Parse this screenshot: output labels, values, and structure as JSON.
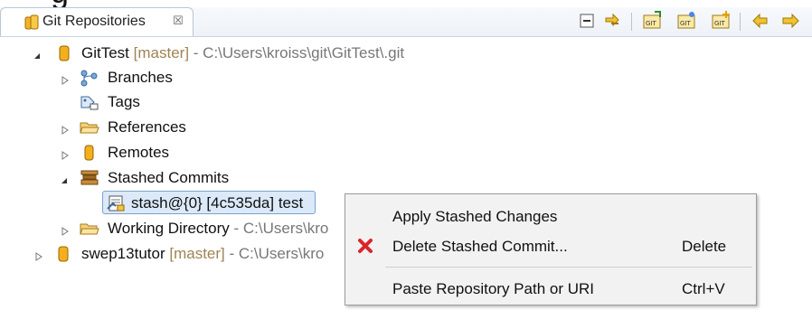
{
  "view": {
    "title": "Git Repositories",
    "close_glyph": "☒"
  },
  "toolbar": [
    {
      "icon": "collapse-all-icon"
    },
    {
      "icon": "link-with-selection-icon"
    },
    {
      "icon": "add-existing-repository-icon"
    },
    {
      "icon": "clone-repository-icon"
    },
    {
      "icon": "create-repository-icon"
    },
    {
      "icon": "refresh-icon"
    },
    {
      "icon": "link-icon"
    }
  ],
  "tree": {
    "repo1": {
      "name": "GitTest",
      "branch": "[master]",
      "path": "- C:\\Users\\kroiss\\git\\GitTest\\.git"
    },
    "branches": "Branches",
    "tags": "Tags",
    "references": "References",
    "remotes": "Remotes",
    "stashed_commits": "Stashed Commits",
    "stash_entry": "stash@{0} [4c535da] test",
    "working_directory": "Working Directory",
    "working_directory_path": "- C:\\Users\\kro",
    "repo2": {
      "name": "swep13tutor",
      "branch": "[master]",
      "path": "- C:\\Users\\kro"
    }
  },
  "context_menu": {
    "items": [
      {
        "label": "Apply Stashed Changes",
        "accel": ""
      },
      {
        "label": "Delete Stashed Commit...",
        "accel": "Delete",
        "icon": "delete-icon"
      },
      {
        "label": "Paste Repository Path or URI",
        "accel": "Ctrl+V"
      }
    ]
  },
  "colors": {
    "branch_text": "#a08354",
    "selection": "#dbe9f9",
    "delete_icon": "#d9262b"
  }
}
